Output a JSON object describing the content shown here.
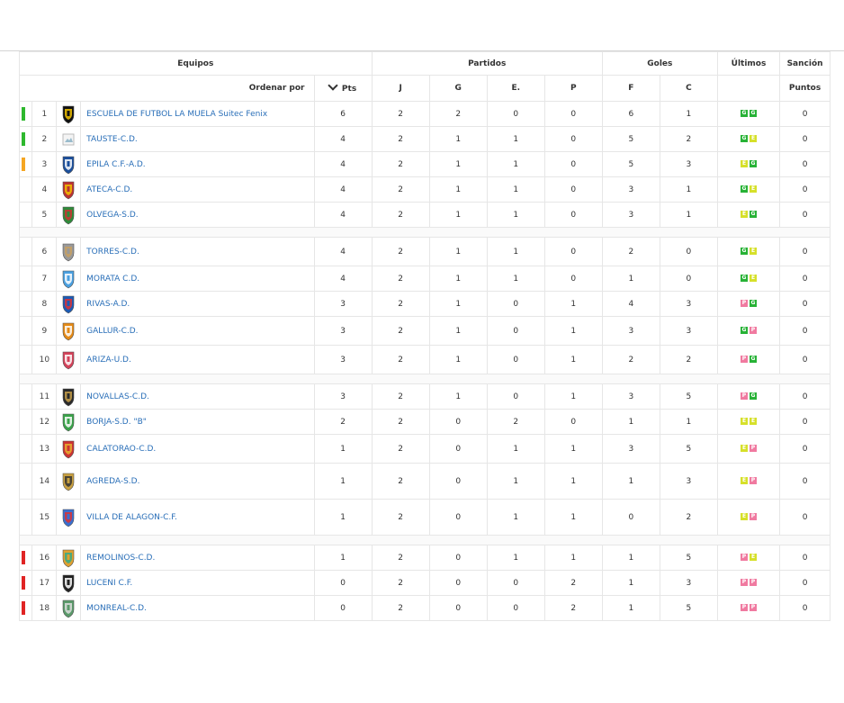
{
  "headers": {
    "equipos": "Equipos",
    "partidos": "Partidos",
    "goles": "Goles",
    "ultimos": "Últimos",
    "sancion": "Sanción",
    "ordenar": "Ordenar por",
    "pts": "Pts",
    "j": "J",
    "g": "G",
    "e": "E.",
    "p": "P",
    "f": "F",
    "c": "C",
    "puntos": "Puntos"
  },
  "colors": {
    "promote": "#2eb82e",
    "playoff": "#f5a623",
    "relegate": "#e02424",
    "form_g": "#27b236",
    "form_e": "#d6e02a",
    "form_p": "#f07aa0"
  },
  "rows": [
    {
      "pos": "1",
      "team": "ESCUELA DE FUTBOL LA MUELA Suitec Fenix",
      "pts": "6",
      "j": "2",
      "g": "2",
      "e": "0",
      "p": "0",
      "f": "6",
      "c": "1",
      "sancion": "0",
      "form": [
        "G",
        "G"
      ],
      "status": "promote",
      "icon": "shield-icon-black"
    },
    {
      "pos": "2",
      "team": "TAUSTE-C.D.",
      "pts": "4",
      "j": "2",
      "g": "1",
      "e": "1",
      "p": "0",
      "f": "5",
      "c": "2",
      "sancion": "0",
      "form": [
        "G",
        "E"
      ],
      "status": "promote",
      "icon": "broken-image-icon"
    },
    {
      "pos": "3",
      "team": "EPILA C.F.-A.D.",
      "pts": "4",
      "j": "2",
      "g": "1",
      "e": "1",
      "p": "0",
      "f": "5",
      "c": "3",
      "sancion": "0",
      "form": [
        "E",
        "G"
      ],
      "status": "playoff",
      "icon": "striped-shield-icon"
    },
    {
      "pos": "4",
      "team": "ATECA-C.D.",
      "pts": "4",
      "j": "2",
      "g": "1",
      "e": "1",
      "p": "0",
      "f": "3",
      "c": "1",
      "sancion": "0",
      "form": [
        "G",
        "E"
      ],
      "status": "none",
      "icon": "square-crest-icon"
    },
    {
      "pos": "5",
      "team": "OLVEGA-S.D.",
      "pts": "4",
      "j": "2",
      "g": "1",
      "e": "1",
      "p": "0",
      "f": "3",
      "c": "1",
      "sancion": "0",
      "form": [
        "E",
        "G"
      ],
      "status": "none",
      "icon": "green-crest-icon"
    },
    {
      "pos": "6",
      "team": "TORRES-C.D.",
      "pts": "4",
      "j": "2",
      "g": "1",
      "e": "1",
      "p": "0",
      "f": "2",
      "c": "0",
      "sancion": "0",
      "form": [
        "G",
        "E"
      ],
      "status": "none",
      "icon": "tower-crest-icon"
    },
    {
      "pos": "7",
      "team": "MORATA C.D.",
      "pts": "4",
      "j": "2",
      "g": "1",
      "e": "1",
      "p": "0",
      "f": "1",
      "c": "0",
      "sancion": "0",
      "form": [
        "G",
        "E"
      ],
      "status": "none",
      "icon": "blue-wing-crest-icon"
    },
    {
      "pos": "8",
      "team": "RIVAS-A.D.",
      "pts": "3",
      "j": "2",
      "g": "1",
      "e": "0",
      "p": "1",
      "f": "4",
      "c": "3",
      "sancion": "0",
      "form": [
        "P",
        "G"
      ],
      "status": "none",
      "icon": "blue-shield-icon"
    },
    {
      "pos": "9",
      "team": "GALLUR-C.D.",
      "pts": "3",
      "j": "2",
      "g": "1",
      "e": "0",
      "p": "1",
      "f": "3",
      "c": "3",
      "sancion": "0",
      "form": [
        "G",
        "P"
      ],
      "status": "none",
      "icon": "orange-shield-icon"
    },
    {
      "pos": "10",
      "team": "ARIZA-U.D.",
      "pts": "3",
      "j": "2",
      "g": "1",
      "e": "0",
      "p": "1",
      "f": "2",
      "c": "2",
      "sancion": "0",
      "form": [
        "P",
        "G"
      ],
      "status": "none",
      "icon": "red-stripe-crest-icon"
    },
    {
      "pos": "11",
      "team": "NOVALLAS-C.D.",
      "pts": "3",
      "j": "2",
      "g": "1",
      "e": "0",
      "p": "1",
      "f": "3",
      "c": "5",
      "sancion": "0",
      "form": [
        "P",
        "G"
      ],
      "status": "none",
      "icon": "cup-crest-icon"
    },
    {
      "pos": "12",
      "team": "BORJA-S.D. \"B\"",
      "pts": "2",
      "j": "2",
      "g": "0",
      "e": "2",
      "p": "0",
      "f": "1",
      "c": "1",
      "sancion": "0",
      "form": [
        "E",
        "E"
      ],
      "status": "none",
      "icon": "green-badge-icon"
    },
    {
      "pos": "13",
      "team": "CALATORAO-C.D.",
      "pts": "1",
      "j": "2",
      "g": "0",
      "e": "1",
      "p": "1",
      "f": "3",
      "c": "5",
      "sancion": "0",
      "form": [
        "E",
        "P"
      ],
      "status": "none",
      "icon": "red-gold-crest-icon"
    },
    {
      "pos": "14",
      "team": "AGREDA-S.D.",
      "pts": "1",
      "j": "2",
      "g": "0",
      "e": "1",
      "p": "1",
      "f": "1",
      "c": "3",
      "sancion": "0",
      "form": [
        "E",
        "P"
      ],
      "status": "none",
      "icon": "crown-crest-icon"
    },
    {
      "pos": "15",
      "team": "VILLA DE ALAGON-C.F.",
      "pts": "1",
      "j": "2",
      "g": "0",
      "e": "1",
      "p": "1",
      "f": "0",
      "c": "2",
      "sancion": "0",
      "form": [
        "E",
        "P"
      ],
      "status": "none",
      "icon": "red-blue-shield-icon"
    },
    {
      "pos": "16",
      "team": "REMOLINOS-C.D.",
      "pts": "1",
      "j": "2",
      "g": "0",
      "e": "1",
      "p": "1",
      "f": "1",
      "c": "5",
      "sancion": "0",
      "form": [
        "P",
        "E"
      ],
      "status": "relegate",
      "icon": "small-figure-icon"
    },
    {
      "pos": "17",
      "team": "LUCENI C.F.",
      "pts": "0",
      "j": "2",
      "g": "0",
      "e": "0",
      "p": "2",
      "f": "1",
      "c": "3",
      "sancion": "0",
      "form": [
        "P",
        "P"
      ],
      "status": "relegate",
      "icon": "bw-stripe-shield-icon"
    },
    {
      "pos": "18",
      "team": "MONREAL-C.D.",
      "pts": "0",
      "j": "2",
      "g": "0",
      "e": "0",
      "p": "2",
      "f": "1",
      "c": "5",
      "sancion": "0",
      "form": [
        "P",
        "P"
      ],
      "status": "relegate",
      "icon": "green-round-crest-icon"
    }
  ]
}
